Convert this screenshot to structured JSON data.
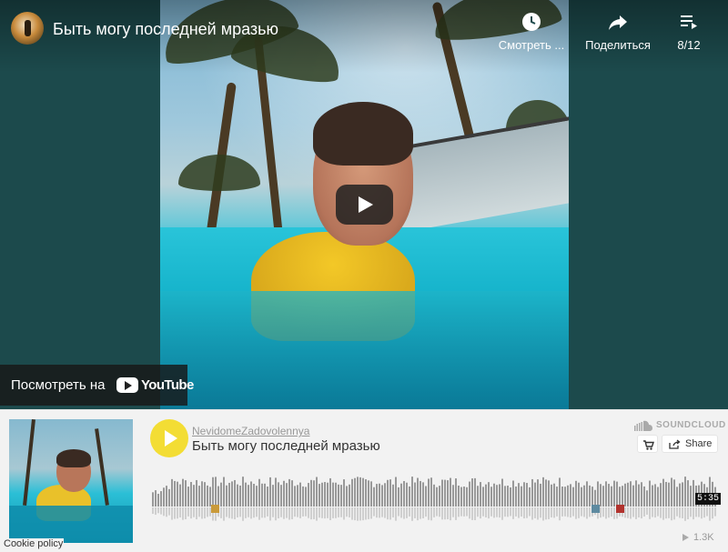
{
  "youtube": {
    "video_title": "Быть могу последней мразью",
    "actions": {
      "watch_later": "Смотреть ...",
      "share": "Поделиться",
      "playlist_position": "8/12"
    },
    "watch_on_label": "Посмотреть на",
    "logo_word": "YouTube",
    "colors": {
      "background": "#1c4a4c",
      "play_button": "#212121"
    }
  },
  "soundcloud": {
    "user": "NevidomeZadovolennya",
    "track_title": "Быть могу последней мразью",
    "logo_word": "SOUNDCLOUD",
    "share_label": "Share",
    "duration": "5:35",
    "plays": "1.3K",
    "cookie_policy": "Cookie policy",
    "colors": {
      "play_button": "#f3dd34",
      "waveform": "#999999"
    }
  }
}
